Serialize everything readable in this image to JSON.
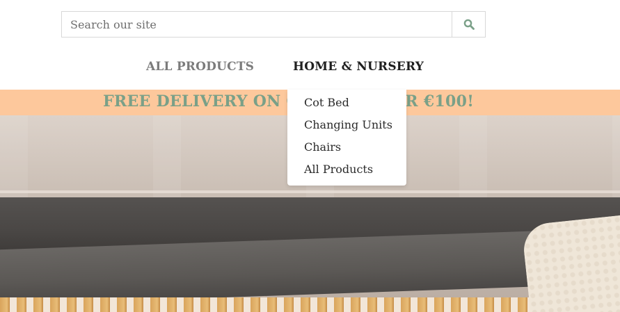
{
  "search": {
    "placeholder": "Search our site",
    "value": "",
    "icon": "search-icon"
  },
  "nav": {
    "items": [
      {
        "label": "ALL PRODUCTS",
        "color": "#7b7b7b"
      },
      {
        "label": "HOME & NURSERY",
        "color": "#1f1f1f"
      }
    ]
  },
  "banner": {
    "text": "FREE DELIVERY ON ORDERS OVER €100!",
    "background": "#fdc89c",
    "text_color": "#7aa088"
  },
  "dropdown": {
    "items": [
      {
        "label": "Cot Bed"
      },
      {
        "label": "Changing Units"
      },
      {
        "label": "Chairs"
      },
      {
        "label": "All Products"
      }
    ]
  },
  "hero": {
    "alt": ""
  }
}
